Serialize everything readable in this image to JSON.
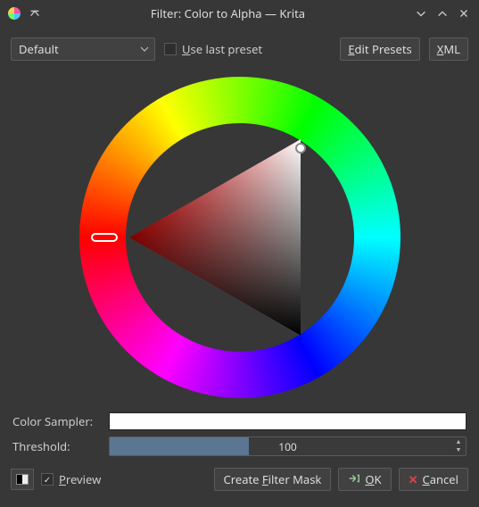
{
  "window": {
    "title": "Filter: Color to Alpha — Krita"
  },
  "toolbar": {
    "preset_value": "Default",
    "use_last_preset_label": "Use last preset",
    "use_last_preset_checked": false,
    "edit_presets_label": "Edit Presets",
    "xml_label": "XML"
  },
  "color_picker": {
    "hue_deg": 0,
    "selected_hex": "#ffffff"
  },
  "fields": {
    "color_sampler_label": "Color Sampler:",
    "color_sampler_hex": "#ffffff",
    "threshold_label": "Threshold:",
    "threshold_value": "100",
    "threshold_max": 255
  },
  "bottom": {
    "preview_label": "Preview",
    "preview_checked": true,
    "create_filter_mask_label": "Create Filter Mask",
    "ok_label": "OK",
    "cancel_label": "Cancel"
  }
}
